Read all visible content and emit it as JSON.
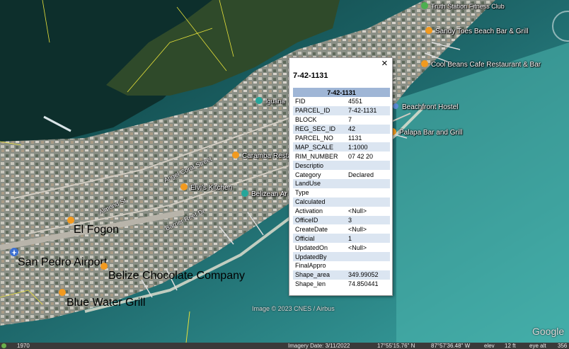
{
  "popup": {
    "header": "7-42-1131",
    "table_title": "7-42-1131",
    "close_glyph": "×",
    "rows": [
      {
        "key": "FID",
        "value": "4551"
      },
      {
        "key": "PARCEL_ID",
        "value": "7-42-1131"
      },
      {
        "key": "BLOCK",
        "value": "7"
      },
      {
        "key": "REG_SEC_ID",
        "value": "42"
      },
      {
        "key": "PARCEL_NO",
        "value": "1131"
      },
      {
        "key": "MAP_SCALE",
        "value": "1:1000"
      },
      {
        "key": "RIM_NUMBER",
        "value": "07 42 20"
      },
      {
        "key": "Descriptio",
        "value": ""
      },
      {
        "key": "Category",
        "value": "Declared"
      },
      {
        "key": "LandUse",
        "value": ""
      },
      {
        "key": "Type",
        "value": ""
      },
      {
        "key": "Calculated",
        "value": ""
      },
      {
        "key": "Activation",
        "value": "<Null>"
      },
      {
        "key": "OfficeID",
        "value": "3"
      },
      {
        "key": "CreateDate",
        "value": "<Null>"
      },
      {
        "key": "Official",
        "value": "1"
      },
      {
        "key": "UpdatedOn",
        "value": "<Null>"
      },
      {
        "key": "UpdatedBy",
        "value": ""
      },
      {
        "key": "FinalAppro",
        "value": ""
      },
      {
        "key": "Shape_area",
        "value": "349.99052"
      },
      {
        "key": "Shape_len",
        "value": "74.850441"
      }
    ]
  },
  "places": [
    {
      "name": "Sandy Toes Beach Bar & Grill",
      "icon": "orange-pin-icon"
    },
    {
      "name": "Cool Beans Cafe Restaurant & Bar",
      "icon": "orange-pin-icon"
    },
    {
      "name": "Beachfront Hostel",
      "icon": "hostel-pin-icon"
    },
    {
      "name": "Palapa Bar and Grill",
      "icon": "orange-pin-icon"
    },
    {
      "name": "Caramba Resta",
      "icon": "orange-pin-icon"
    },
    {
      "name": "Elvi's Kitchen",
      "icon": "orange-pin-icon"
    },
    {
      "name": "Belizean Ar",
      "icon": "teal-pin-icon"
    },
    {
      "name": "El Fogon",
      "icon": "orange-pin-icon"
    },
    {
      "name": "San Pedro Airport",
      "icon": "airport-icon"
    },
    {
      "name": "Belize Chocolate Company",
      "icon": "orange-pin-icon"
    },
    {
      "name": "Blue Water Grill",
      "icon": "orange-pin-icon"
    },
    {
      "name": "Iguana",
      "icon": "teal-pin-icon"
    },
    {
      "name": "Truth Station Fitness Club",
      "icon": "green-pin-icon"
    }
  ],
  "streets": [
    "Angel Coral Street",
    "Almond St",
    "Barrier Reef Dr"
  ],
  "copyright": "Image © 2023 CNES / Airbus",
  "google_logo": "Google",
  "status": {
    "year": "1970",
    "imagery_date": "Imagery Date: 3/11/2022",
    "lat": "17°55'15.76\" N",
    "lon": "87°57'36.48\" W",
    "elev": "elev",
    "elev_value": "12 ft",
    "eye_alt": "eye alt",
    "eye_alt_value": "356"
  }
}
